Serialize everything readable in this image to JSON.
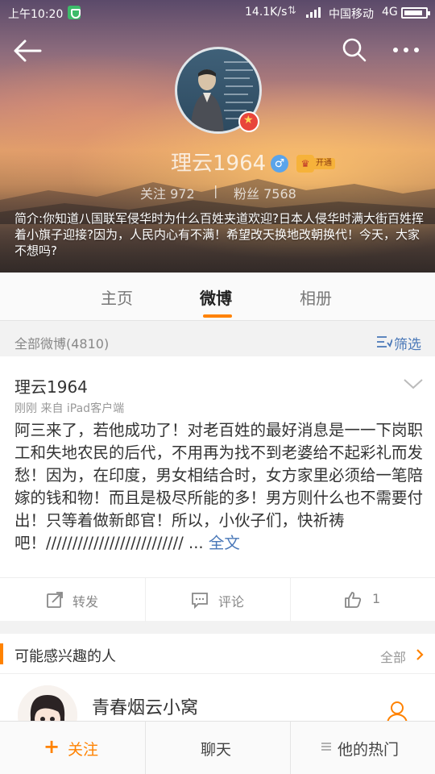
{
  "status_bar": {
    "time": "上午10:20",
    "speed": "14.1K/s",
    "carrier": "中国移动",
    "network": "4G"
  },
  "profile": {
    "name": "理云1964",
    "gender_symbol": "♂",
    "vip_tag": "开通",
    "following_label": "关注",
    "following_count": "972",
    "separator": "|",
    "followers_label": "粉丝",
    "followers_count": "7568",
    "bio": "简介:你知道八国联军侵华时为什么百姓夹道欢迎?日本人侵华时满大街百姓挥着小旗子迎接?因为，人民内心有不满！希望改天换地改朝换代！今天，大家不想吗?"
  },
  "tabs": [
    {
      "label": "主页",
      "active": false
    },
    {
      "label": "微博",
      "active": true
    },
    {
      "label": "相册",
      "active": false
    }
  ],
  "filter_bar": {
    "all_label": "全部微博(4810)",
    "filter_label": "筛选"
  },
  "post": {
    "author": "理云1964",
    "meta": "刚刚   来自 iPad客户端",
    "body": "阿三来了，若他成功了！对老百姓的最好消息是一一下岗职工和失地农民的后代，不用再为找不到老婆给不起彩礼而发愁！因为，在印度，男女相结合时，女方家里必须给一笔陪嫁的钱和物！而且是极尽所能的多！男方则什么也不需要付出！只等着做新郎官！所以，小伙子们，快祈祷吧！////////////////////////// ... ",
    "more_label": "全文",
    "actions": {
      "repost": "转发",
      "comment": "评论",
      "like_count": "1"
    }
  },
  "suggestions": {
    "title": "可能感兴趣的人",
    "all_label": "全部",
    "user_name": "青春烟云小窝"
  },
  "bottom_bar": {
    "follow_plus": "+",
    "follow_label": "关注",
    "chat_label": "聊天",
    "hot_label": "他的热门"
  },
  "colors": {
    "accent": "#ff8200",
    "link": "#4a78b8"
  }
}
